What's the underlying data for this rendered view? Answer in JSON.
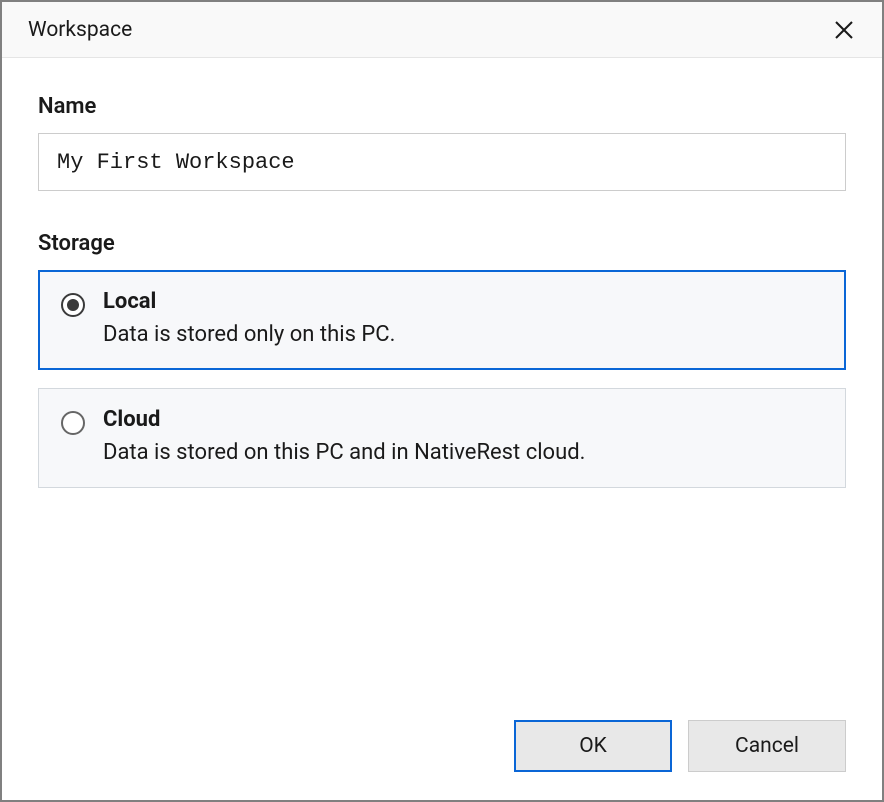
{
  "dialog": {
    "title": "Workspace"
  },
  "form": {
    "name_label": "Name",
    "name_value": "My First Workspace",
    "storage_label": "Storage",
    "storage_options": [
      {
        "id": "local",
        "title": "Local",
        "description": "Data is stored only on this PC.",
        "selected": true
      },
      {
        "id": "cloud",
        "title": "Cloud",
        "description": "Data is stored on this PC and in NativeRest cloud.",
        "selected": false
      }
    ]
  },
  "buttons": {
    "ok": "OK",
    "cancel": "Cancel"
  }
}
